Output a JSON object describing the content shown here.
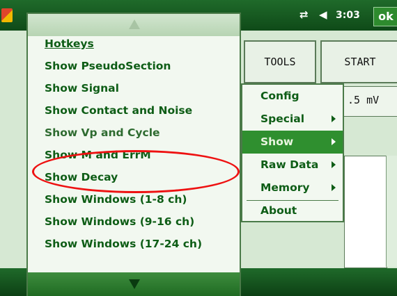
{
  "status_bar": {
    "time": "3:03",
    "ok_label": "ok",
    "network_icon": "network-arrows-icon",
    "volume_icon": "speaker-icon"
  },
  "toolbar": {
    "tools_label": "TOOLS",
    "start_label": "START"
  },
  "background": {
    "value_text": ".5 mV"
  },
  "show_menu": {
    "items": [
      "Hotkeys",
      "Show PseudoSection",
      "Show Signal",
      "Show Contact and Noise",
      "Show Vp and Cycle",
      "Show M and ErrM",
      "Show Decay",
      "Show Windows (1-8 ch)",
      "Show Windows (9-16 ch)",
      "Show Windows (17-24 ch)"
    ]
  },
  "tools_menu": {
    "items": [
      "Config",
      "Special",
      "Show",
      "Raw Data",
      "Memory",
      "About"
    ],
    "selected": "Show"
  },
  "colors": {
    "accent": "#2f8f2f",
    "menu_text": "#0e5d16",
    "highlight_oval": "#e11111"
  }
}
